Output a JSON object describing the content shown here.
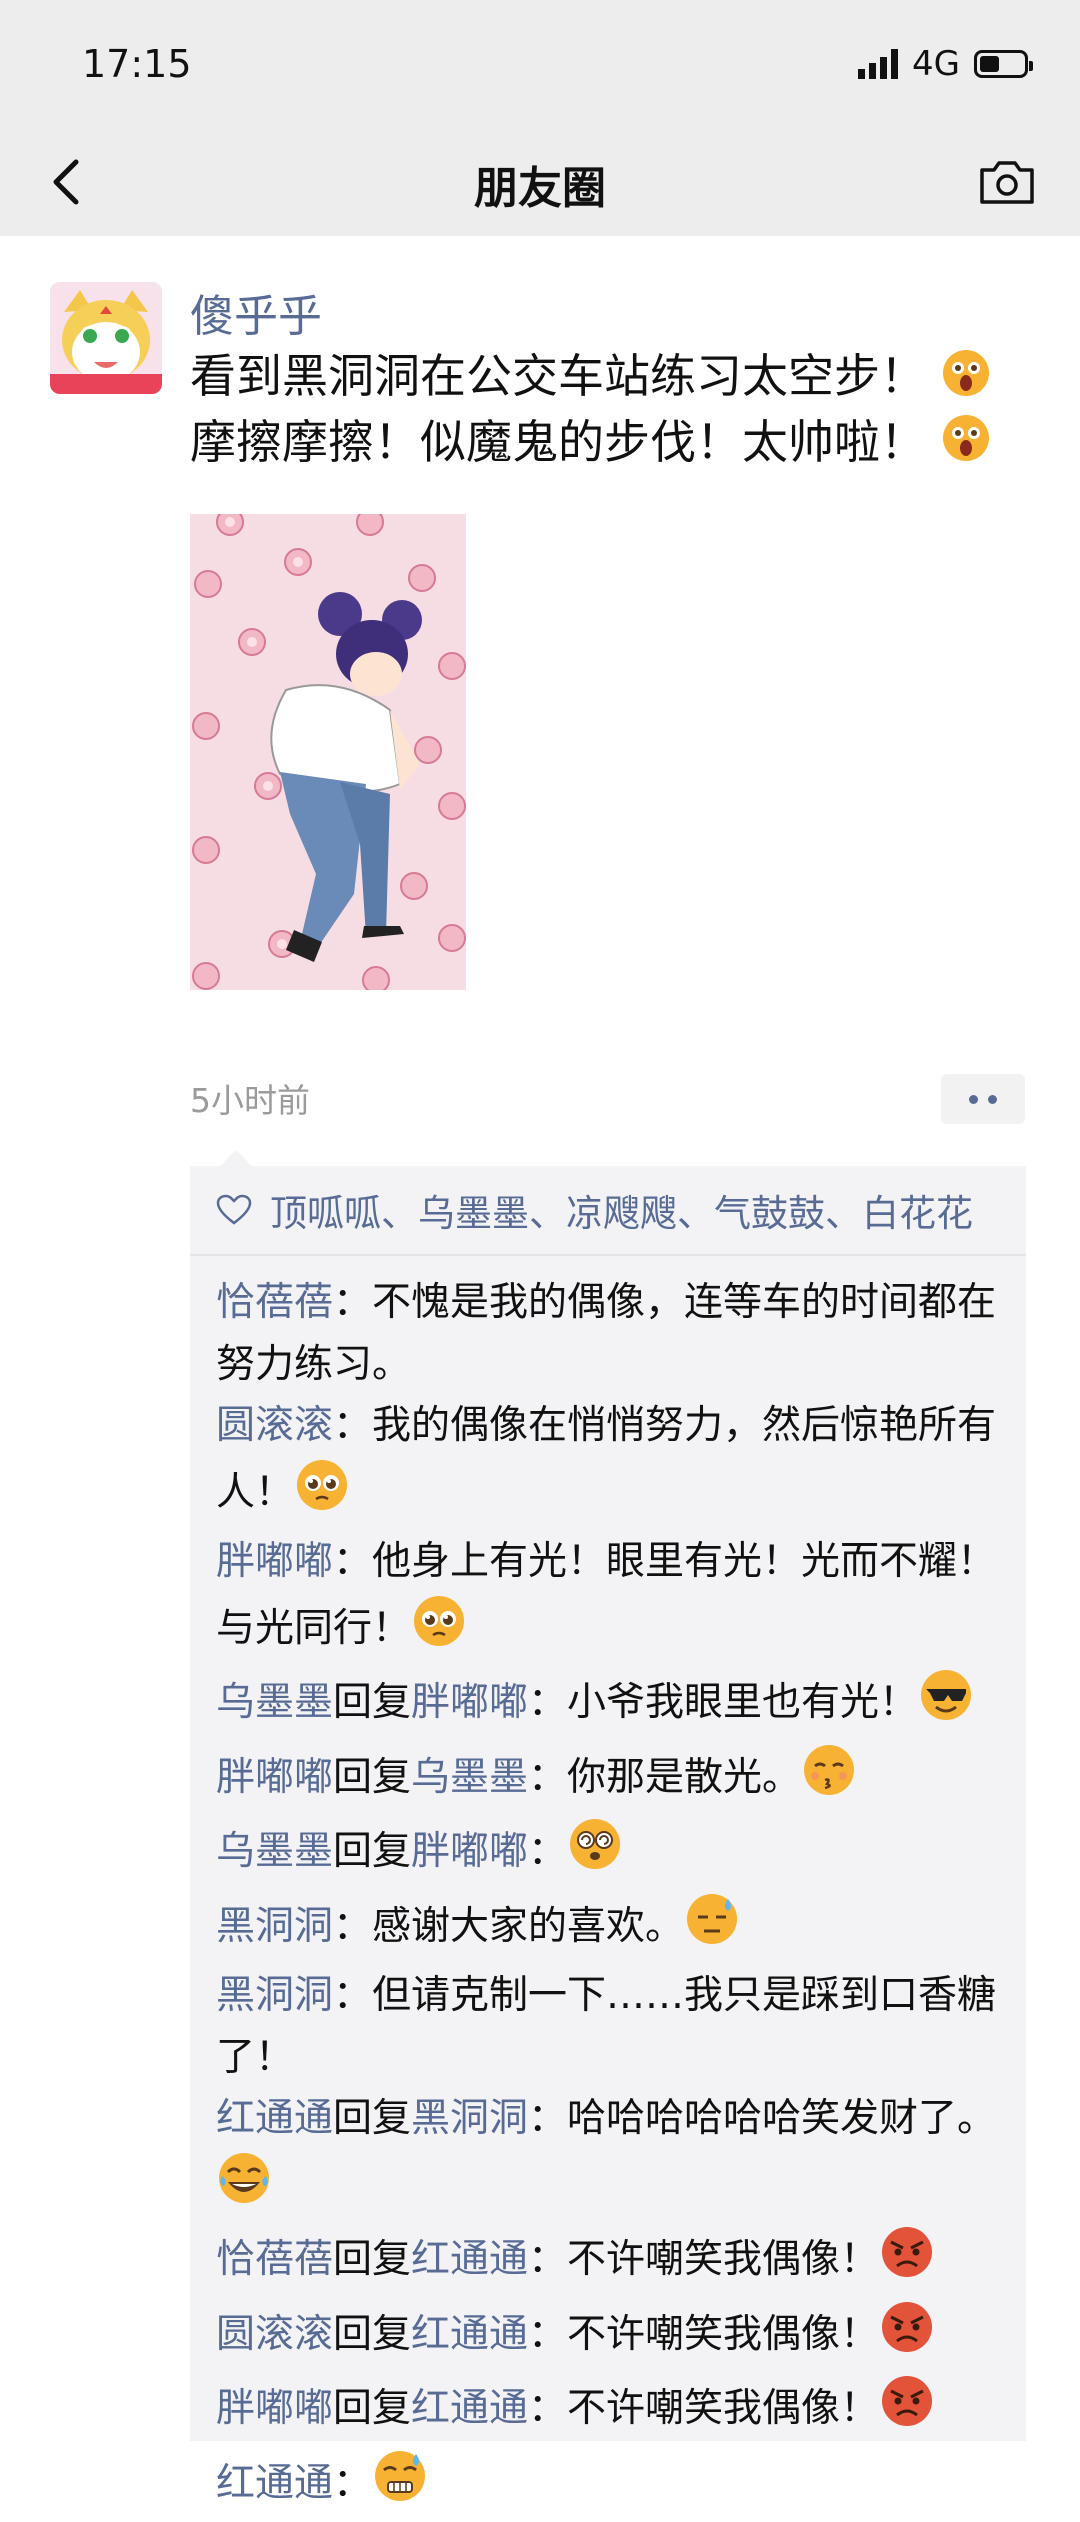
{
  "status_bar": {
    "time": "17:15",
    "network": "4G",
    "signal_bars": 4,
    "battery_level": 0.45
  },
  "nav": {
    "title": "朋友圈",
    "back_icon": "chevron-left-icon",
    "camera_icon": "camera-icon"
  },
  "post": {
    "author": "傻乎乎",
    "line1": "看到黑洞洞在公交车站练习太空步！",
    "line2": "摩擦摩擦！似魔鬼的步伐！太帅啦！",
    "time": "5小时前"
  },
  "likes": {
    "names": "顶呱呱、乌墨墨、凉飕飕、气鼓鼓、白花花"
  },
  "comments": [
    {
      "name": "恰蓓蓓",
      "reply_word": "",
      "reply_to": "",
      "text": "：不愧是我的偶像，连等车的时间都在努力练习。",
      "emoji": ""
    },
    {
      "name": "圆滚滚",
      "reply_word": "",
      "reply_to": "",
      "text": "：我的偶像在悄悄努力，然后惊艳所有人！",
      "emoji": "pleading"
    },
    {
      "name": "胖嘟嘟",
      "reply_word": "",
      "reply_to": "",
      "text": "：他身上有光！眼里有光！光而不耀！与光同行！",
      "emoji": "pleading"
    },
    {
      "name": "乌墨墨",
      "reply_word": "回复",
      "reply_to": "胖嘟嘟",
      "text": "：小爷我眼里也有光！",
      "emoji": "sunglasses"
    },
    {
      "name": "胖嘟嘟",
      "reply_word": "回复",
      "reply_to": "乌墨墨",
      "text": "：你那是散光。",
      "emoji": "kissing"
    },
    {
      "name": "乌墨墨",
      "reply_word": "回复",
      "reply_to": "胖嘟嘟",
      "text": "：",
      "emoji": "dizzy"
    },
    {
      "name": "黑洞洞",
      "reply_word": "",
      "reply_to": "",
      "text": "：感谢大家的喜欢。",
      "emoji": "sweat"
    },
    {
      "name": "黑洞洞",
      "reply_word": "",
      "reply_to": "",
      "text": "：但请克制一下……我只是踩到口香糖了！",
      "emoji": ""
    },
    {
      "name": "红通通",
      "reply_word": "回复",
      "reply_to": "黑洞洞",
      "text": "：哈哈哈哈哈哈笑发财了。",
      "emoji": "laugh-tears"
    },
    {
      "name": "恰蓓蓓",
      "reply_word": "回复",
      "reply_to": "红通通",
      "text": "：不许嘲笑我偶像！",
      "emoji": "angry"
    },
    {
      "name": "圆滚滚",
      "reply_word": "回复",
      "reply_to": "红通通",
      "text": "：不许嘲笑我偶像！",
      "emoji": "angry"
    },
    {
      "name": "胖嘟嘟",
      "reply_word": "回复",
      "reply_to": "红通通",
      "text": "：不许嘲笑我偶像！",
      "emoji": "angry"
    },
    {
      "name": "红通通",
      "reply_word": "",
      "reply_to": "",
      "text": "：",
      "emoji": "grimace-sweat"
    }
  ],
  "colors": {
    "link": "#576b95",
    "bar_bg": "#ededed",
    "comment_bg": "#f3f3f5",
    "timestamp": "#9b9b9b"
  }
}
